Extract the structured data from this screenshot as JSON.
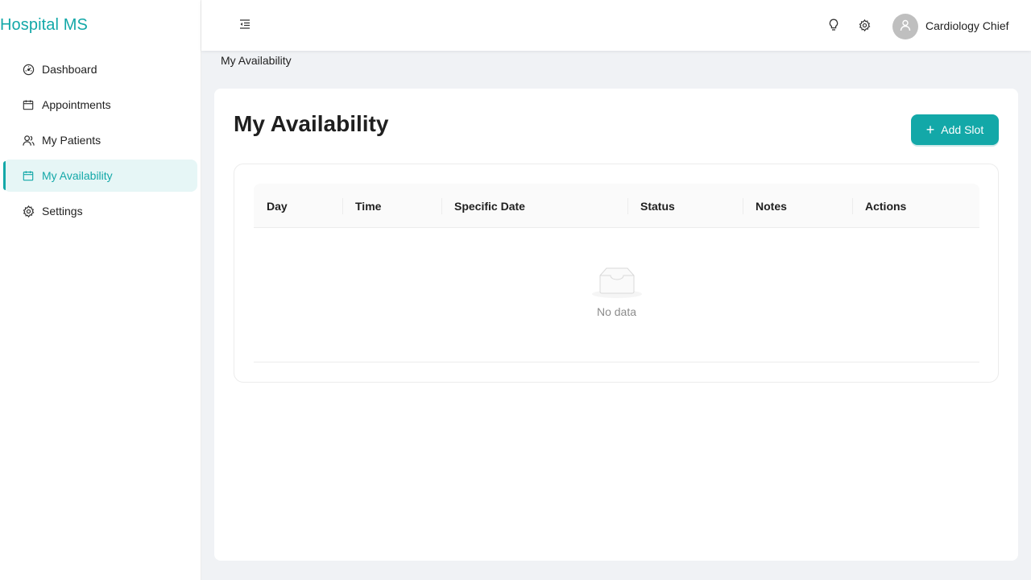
{
  "app": {
    "brand": "Hospital MS",
    "accent_color": "#13a8a8"
  },
  "sidebar": {
    "items": [
      {
        "label": "Dashboard",
        "icon": "dashboard-icon",
        "active": false
      },
      {
        "label": "Appointments",
        "icon": "calendar-icon",
        "active": false
      },
      {
        "label": "My Patients",
        "icon": "users-icon",
        "active": false
      },
      {
        "label": "My Availability",
        "icon": "calendar-icon",
        "active": true
      },
      {
        "label": "Settings",
        "icon": "gear-icon",
        "active": false
      }
    ]
  },
  "header": {
    "collapse_icon": "menu-fold-icon",
    "icons": [
      "bulb-icon",
      "gear-icon"
    ],
    "user": {
      "name": "Cardiology Chief",
      "avatar_icon": "user-icon"
    }
  },
  "breadcrumb": {
    "current": "My Availability"
  },
  "main": {
    "title": "My Availability",
    "add_button_label": "Add Slot",
    "table": {
      "columns": [
        "Day",
        "Time",
        "Specific Date",
        "Status",
        "Notes",
        "Actions"
      ],
      "rows": [],
      "empty_text": "No data"
    }
  }
}
